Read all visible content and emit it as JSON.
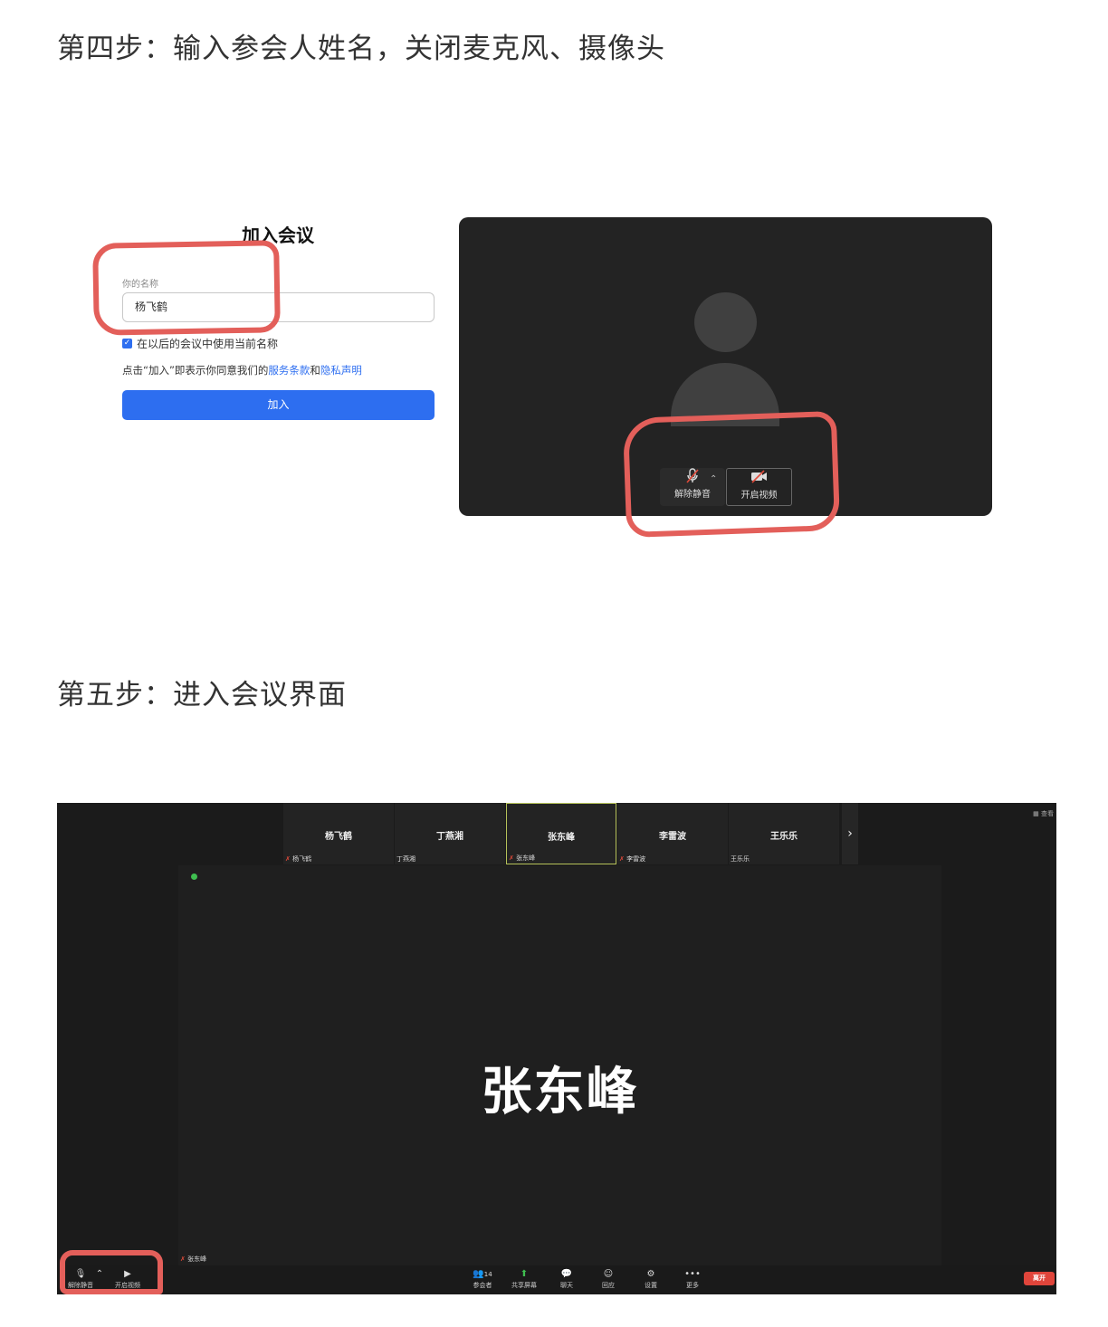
{
  "step4": {
    "heading": "第四步：输入参会人姓名，关闭麦克风、摄像头"
  },
  "join_form": {
    "title": "加入会议",
    "name_label": "你的名称",
    "name_value": "杨飞鹤",
    "remember_label": "在以后的会议中使用当前名称",
    "remember_checked": true,
    "terms_prefix": "点击“加入”即表示你同意我们的",
    "terms_link": "服务条款",
    "terms_and": "和",
    "privacy_link": "隐私声明",
    "join_button": "加入"
  },
  "preview": {
    "mute_label": "解除静音",
    "mute_icon": "mic-muted-icon",
    "video_label": "开启视频",
    "video_icon": "video-off-icon"
  },
  "step5": {
    "heading": "第五步：进入会议界面"
  },
  "meeting": {
    "participants": [
      {
        "name": "杨飞鹤",
        "label": "杨飞鹤",
        "muted": true,
        "active": false
      },
      {
        "name": "丁燕湘",
        "label": "丁燕湘",
        "muted": false,
        "active": false
      },
      {
        "name": "张东峰",
        "label": "张东峰",
        "muted": true,
        "active": true
      },
      {
        "name": "李雷波",
        "label": "李雷波",
        "muted": true,
        "active": false
      },
      {
        "name": "王乐乐",
        "label": "王乐乐",
        "muted": false,
        "active": false
      }
    ],
    "view_label": "查看",
    "speaker_name": "张东峰",
    "speaker_label": "张东峰",
    "toolbar": {
      "unmute": "解除静音",
      "start_video": "开启视频",
      "participants": "参会者",
      "participant_count": "14",
      "share": "共享屏幕",
      "chat": "聊天",
      "reactions": "回应",
      "settings": "设置",
      "more": "更多",
      "leave": "离开"
    }
  },
  "colors": {
    "accent": "#2d6ef0",
    "annotation": "#e35f5a",
    "leave": "#e0453b"
  }
}
